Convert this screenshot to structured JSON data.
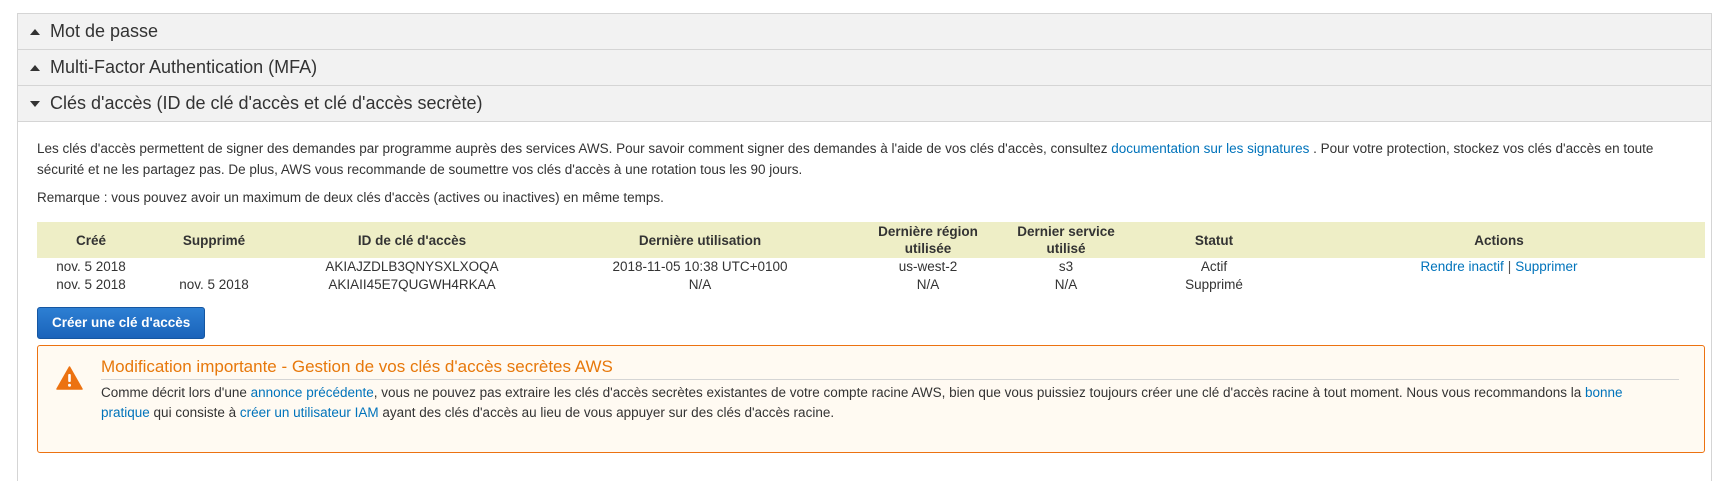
{
  "accordion": {
    "password_title": "Mot de passe",
    "mfa_title": "Multi-Factor Authentication (MFA)",
    "keys_title": "Clés d'accès (ID de clé d'accès et clé d'accès secrète)"
  },
  "intro": {
    "text1": "Les clés d'accès permettent de signer des demandes par programme auprès des services AWS. Pour savoir comment signer des demandes à l'aide de vos clés d'accès, consultez ",
    "doc_link": "documentation sur les signatures",
    "text2": " . Pour votre protection, stockez vos clés d'accès en toute sécurité et ne les partagez pas. De plus, AWS vous recommande de soumettre vos clés d'accès à une rotation tous les 90 jours.",
    "note": "Remarque : vous pouvez avoir un maximum de deux clés d'accès (actives ou inactives) en même temps."
  },
  "table": {
    "headers": {
      "created": "Créé",
      "deleted": "Supprimé",
      "key_id": "ID de clé d'accès",
      "last_used": "Dernière utilisation",
      "last_region": "Dernière région utilisée",
      "last_service": "Dernier service utilisé",
      "status": "Statut",
      "actions": "Actions"
    },
    "rows": [
      {
        "created": "nov. 5 2018",
        "deleted": "",
        "key_id": "AKIAJZDLB3QNYSXLXOQA",
        "last_used": "2018-11-05 10:38 UTC+0100",
        "last_region": "us-west-2",
        "last_service": "s3",
        "status": "Actif",
        "action_deactivate": "Rendre inactif",
        "action_separator": "|",
        "action_delete": "Supprimer"
      },
      {
        "created": "nov. 5 2018",
        "deleted": "nov. 5 2018",
        "key_id": "AKIAII45E7QUGWH4RKAA",
        "last_used": "N/A",
        "last_region": "N/A",
        "last_service": "N/A",
        "status": "Supprimé"
      }
    ]
  },
  "create_button": "Créer une clé d'accès",
  "warning": {
    "title": "Modification importante - Gestion de vos clés d'accès secrètes AWS",
    "t1": "Comme décrit lors d'une ",
    "link1": "annonce précédente",
    "t2": ", vous ne pouvez pas extraire les clés d'accès secrètes existantes de votre compte racine AWS, bien que vous puissiez toujours créer une clé d'accès racine à tout moment. Nous vous recommandons la ",
    "link2": "bonne pratique",
    "t3": " qui consiste à ",
    "link3": "créer un utilisateur IAM",
    "t4": " ayant des clés d'accès au lieu de vous appuyer sur des clés d'accès racine."
  },
  "colors": {
    "link": "#0073bb",
    "button": "#1f6cc5",
    "warning_accent": "#ec7211",
    "table_header_bg": "#eeeec6"
  },
  "icons": {
    "collapsed": "triangle-up-icon",
    "expanded": "triangle-down-icon",
    "warning": "warning-triangle-icon"
  }
}
